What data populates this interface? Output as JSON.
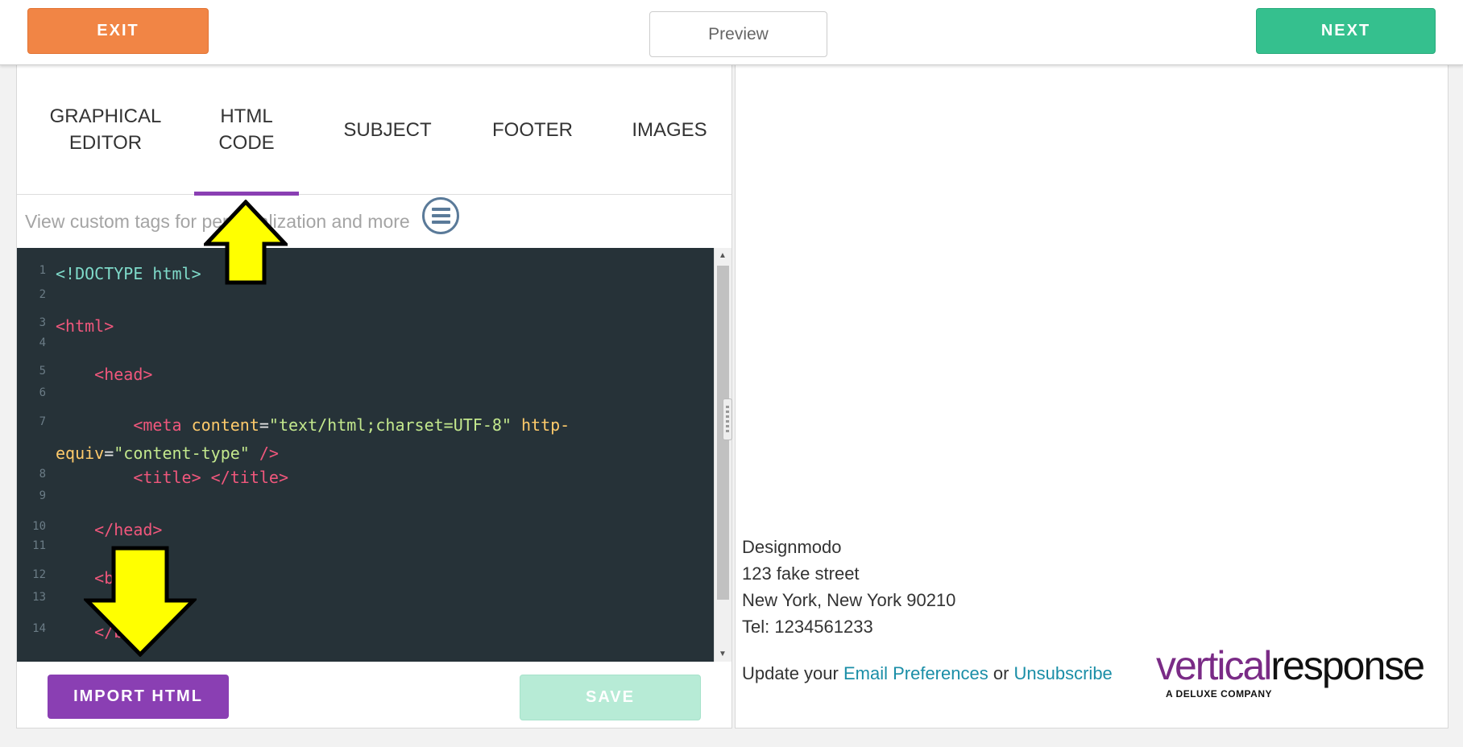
{
  "toolbar": {
    "exit_label": "EXIT",
    "preview_label": "Preview",
    "next_label": "NEXT"
  },
  "tabs": [
    {
      "label": "GRAPHICAL EDITOR"
    },
    {
      "label": "HTML CODE",
      "active": true
    },
    {
      "label": "SUBJECT"
    },
    {
      "label": "FOOTER"
    },
    {
      "label": "IMAGES"
    }
  ],
  "tags_hint": "View custom tags for personalization and more",
  "code_lines": [
    {
      "n": "1",
      "parts": [
        {
          "c": "doc",
          "t": "<!DOCTYPE html>"
        }
      ]
    },
    {
      "n": "2",
      "parts": []
    },
    {
      "n": "3",
      "parts": [
        {
          "c": "tag",
          "t": "<html>"
        }
      ]
    },
    {
      "n": "4",
      "parts": []
    },
    {
      "n": "5",
      "parts": [
        {
          "c": "tag",
          "t": "    <head>"
        }
      ]
    },
    {
      "n": "6",
      "parts": []
    },
    {
      "n": "7",
      "parts": [
        {
          "c": "tag",
          "t": "        <meta "
        },
        {
          "c": "attr",
          "t": "content"
        },
        {
          "c": "plain",
          "t": "="
        },
        {
          "c": "str",
          "t": "\"text/html;charset=UTF-8\""
        },
        {
          "c": "attr",
          "t": " http-"
        }
      ]
    },
    {
      "n": "",
      "parts": [
        {
          "c": "attr",
          "t": "equiv"
        },
        {
          "c": "plain",
          "t": "="
        },
        {
          "c": "str",
          "t": "\"content-type\""
        },
        {
          "c": "tag",
          "t": " />"
        }
      ]
    },
    {
      "n": "8",
      "parts": [
        {
          "c": "tag",
          "t": "        <title> </title>"
        }
      ]
    },
    {
      "n": "9",
      "parts": []
    },
    {
      "n": "10",
      "parts": [
        {
          "c": "tag",
          "t": "    </head>"
        }
      ]
    },
    {
      "n": "11",
      "parts": []
    },
    {
      "n": "12",
      "parts": [
        {
          "c": "tag",
          "t": "    <body>"
        }
      ]
    },
    {
      "n": "13",
      "parts": []
    },
    {
      "n": "14",
      "parts": [
        {
          "c": "tag",
          "t": "    </body>"
        }
      ]
    }
  ],
  "actions": {
    "import_label": "IMPORT HTML",
    "save_label": "SAVE"
  },
  "footer": {
    "address_lines": [
      "Designmodo",
      "123 fake street",
      "New York, New York 90210",
      "Tel: 1234561233"
    ],
    "prefs_prefix": "Update your ",
    "prefs_link": "Email Preferences",
    "prefs_or": " or ",
    "unsubscribe_link": "Unsubscribe"
  },
  "logo": {
    "part1": "vertical",
    "part2": "response",
    "tagline": "A DELUXE COMPANY"
  },
  "colors": {
    "exit": "#f18545",
    "next": "#35c08e",
    "import": "#8a3fb3",
    "save_disabled": "#b7ebd6",
    "active_tab_underline": "#8a3fb3",
    "editor_bg": "#263238",
    "link": "#1a8ea7",
    "annotation_arrow": "#ffff00"
  }
}
